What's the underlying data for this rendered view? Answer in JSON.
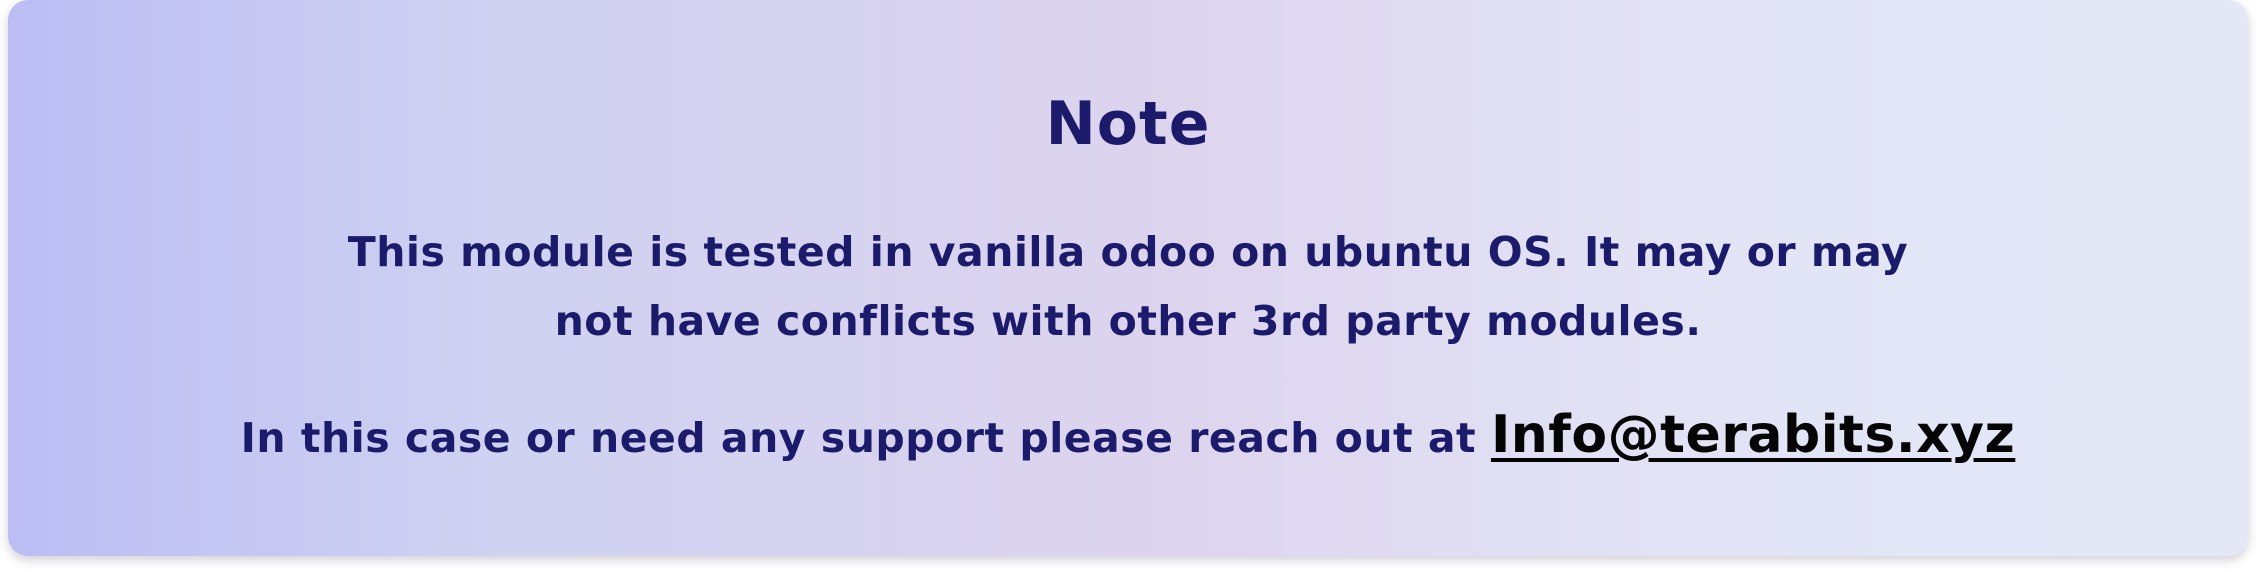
{
  "note": {
    "title": "Note",
    "description": "This module is tested in vanilla odoo on ubuntu OS. It may or may not have conflicts with other 3rd party modules.",
    "support_text": "In this case or need any support please  reach out at ",
    "support_email": "Info@terabits.xyz"
  }
}
